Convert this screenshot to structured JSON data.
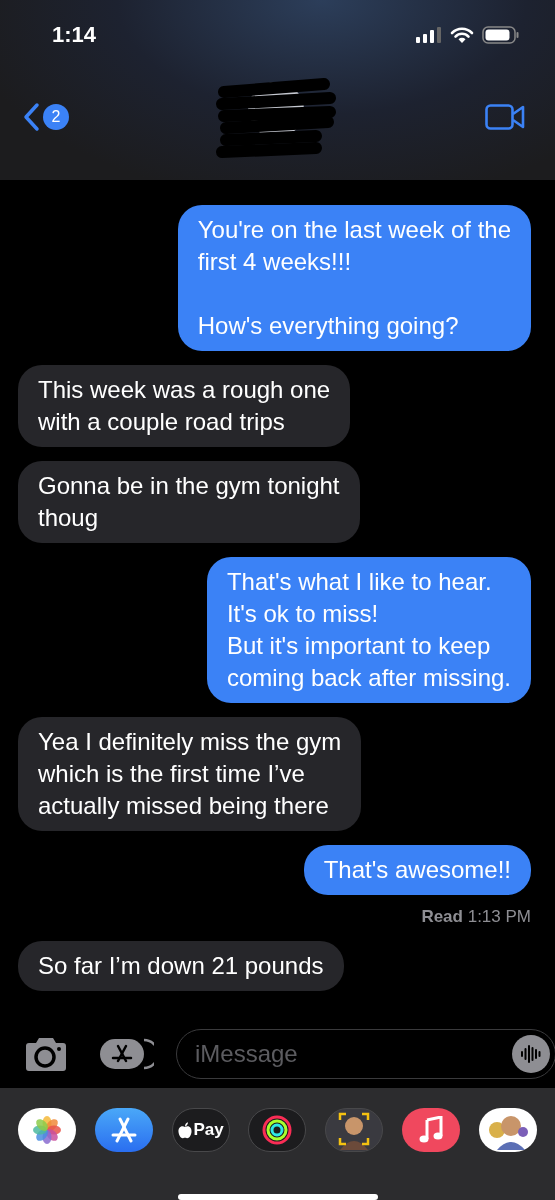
{
  "status_bar": {
    "time": "1:14"
  },
  "nav": {
    "unread_count": "2"
  },
  "messages": [
    {
      "kind": "outgoing",
      "text": "You're on the last week of the\nfirst 4 weeks!!!\n\nHow's everything going?"
    },
    {
      "kind": "incoming",
      "text": "This week was a rough one\nwith a couple road trips"
    },
    {
      "kind": "incoming",
      "text": "Gonna be in the gym tonight\nthoug"
    },
    {
      "kind": "outgoing",
      "text": "That's what I like to hear.\nIt's ok to miss!\nBut it's important to keep\ncoming back after missing."
    },
    {
      "kind": "incoming",
      "text": "Yea I definitely miss the gym\nwhich is the first time I’ve\nactually missed being there"
    },
    {
      "kind": "outgoing",
      "text": "That's awesome!!",
      "receipt": "**Read** 1:13 PM"
    },
    {
      "kind": "incoming",
      "text": "So far I’m down 21 pounds"
    }
  ],
  "composer": {
    "placeholder": "iMessage"
  },
  "app_drawer": [
    {
      "kind": "photos"
    },
    {
      "kind": "app-store"
    },
    {
      "kind": "apple-pay",
      "label": "Pay"
    },
    {
      "kind": "activity"
    },
    {
      "kind": "memoji"
    },
    {
      "kind": "music"
    },
    {
      "kind": "stickers"
    }
  ]
}
